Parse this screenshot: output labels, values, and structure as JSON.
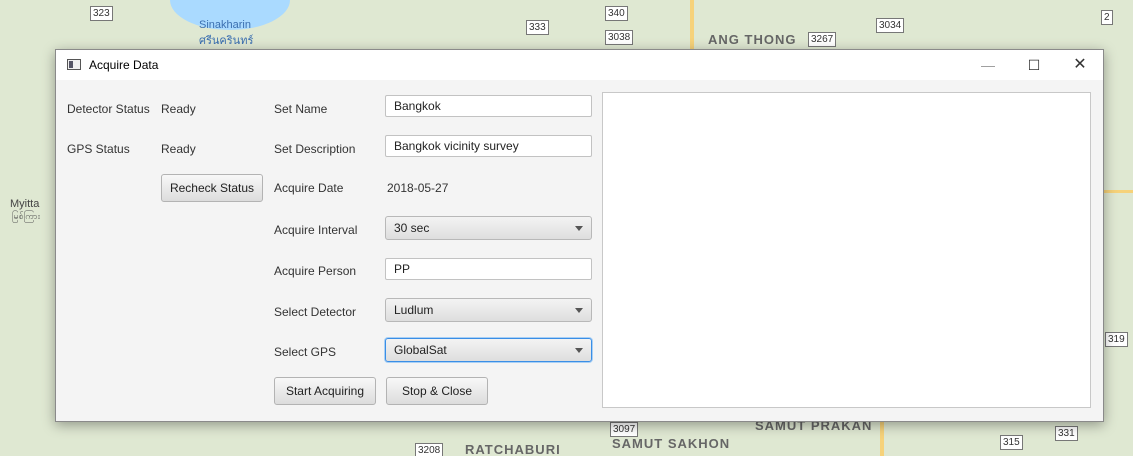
{
  "map": {
    "labels": {
      "sinakharin": "Sinakharin",
      "sinakharin_th": "ศรีนครินทร์",
      "ang_thong": "ANG THONG",
      "myitta": "Myitta",
      "myitta_my": "မြစ်ကြား",
      "samut_prakan": "SAMUT PRAKAN",
      "samut_sakhon": "SAMUT SAKHON",
      "ratchaburi": "RATCHABURI"
    },
    "shields": {
      "s323": "323",
      "s340": "340",
      "s333": "333",
      "s3038": "3038",
      "s3267": "3267",
      "s3034": "3034",
      "s2": "2",
      "s319": "319",
      "s3097": "3097",
      "s3208": "3208",
      "s315": "315",
      "s331": "331"
    }
  },
  "window": {
    "title": "Acquire Data",
    "minimize_glyph": "—",
    "maximize_glyph": "☐",
    "close_glyph": "✕"
  },
  "status": {
    "detector_label": "Detector Status",
    "detector_value": "Ready",
    "gps_label": "GPS Status",
    "gps_value": "Ready",
    "recheck_button": "Recheck Status"
  },
  "form": {
    "set_name_label": "Set Name",
    "set_name_value": "Bangkok",
    "set_description_label": "Set Description",
    "set_description_value": "Bangkok vicinity survey",
    "acquire_date_label": "Acquire Date",
    "acquire_date_value": "2018-05-27",
    "acquire_interval_label": "Acquire Interval",
    "acquire_interval_value": "30 sec",
    "acquire_person_label": "Acquire Person",
    "acquire_person_value": "PP",
    "select_detector_label": "Select Detector",
    "select_detector_value": "Ludlum",
    "select_gps_label": "Select GPS",
    "select_gps_value": "GlobalSat"
  },
  "actions": {
    "start_button": "Start Acquiring",
    "stop_button": "Stop & Close"
  }
}
